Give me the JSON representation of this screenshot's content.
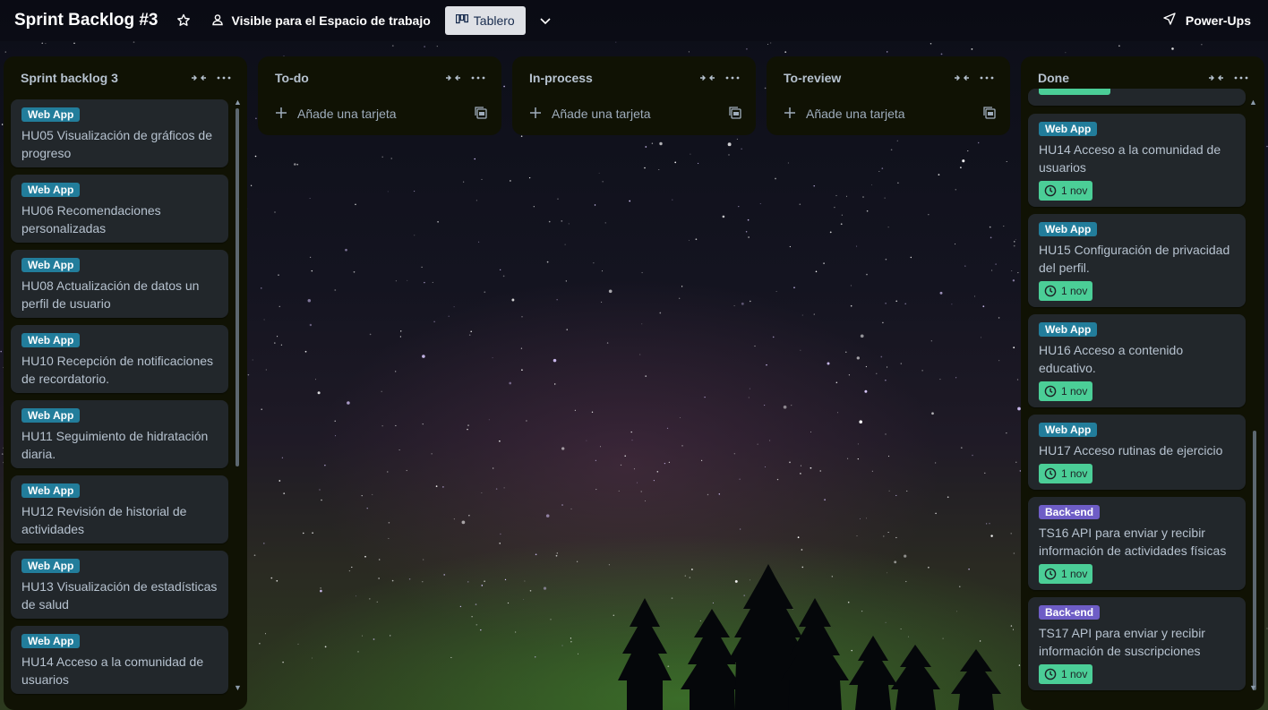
{
  "board": {
    "title": "Sprint Backlog #3",
    "visibility": "Visible para el Espacio de trabajo",
    "view": "Tablero",
    "powerups": "Power-Ups"
  },
  "icons": {
    "star": "star-icon",
    "visibility": "people-icon",
    "view": "board-icon",
    "chevron": "chevron-down-icon",
    "powerups": "rocket-icon",
    "collapse": "collapse-list-icon",
    "more": "more-dots-icon",
    "plus": "plus-icon",
    "template": "template-icon",
    "clock": "clock-icon"
  },
  "colors": {
    "webapp_label": "#227d9b",
    "backend_label": "#6e5dc6",
    "due_badge": "#4bce97",
    "list_bg": "#101204",
    "card_bg": "#22272b"
  },
  "lists": [
    {
      "title": "Sprint backlog 3",
      "cards": [
        {
          "label": "Web App",
          "title": "HU05 Visualización de gráficos de progreso"
        },
        {
          "label": "Web App",
          "title": "HU06 Recomendaciones personalizadas"
        },
        {
          "label": "Web App",
          "title": "HU08 Actualización de datos un perfil de usuario"
        },
        {
          "label": "Web App",
          "title": "HU10 Recepción de notificaciones de recordatorio."
        },
        {
          "label": "Web App",
          "title": "HU11 Seguimiento de hidratación diaria."
        },
        {
          "label": "Web App",
          "title": "HU12 Revisión de historial de actividades"
        },
        {
          "label": "Web App",
          "title": "HU13 Visualización de estadísticas de salud"
        },
        {
          "label": "Web App",
          "title": "HU14 Acceso a la comunidad de usuarios"
        }
      ]
    },
    {
      "title": "To-do",
      "add_label": "Añade una tarjeta"
    },
    {
      "title": "In-process",
      "add_label": "Añade una tarjeta"
    },
    {
      "title": "To-review",
      "add_label": "Añade una tarjeta"
    },
    {
      "title": "Done",
      "cards": [
        {
          "label": "Web App",
          "title": "HU14 Acceso a la comunidad de usuarios",
          "due": "1 nov"
        },
        {
          "label": "Web App",
          "title": "HU15 Configuración de privacidad del perfil.",
          "due": "1 nov"
        },
        {
          "label": "Web App",
          "title": "HU16 Acceso a contenido educativo.",
          "due": "1 nov"
        },
        {
          "label": "Web App",
          "title": "HU17 Acceso rutinas de ejercicio",
          "due": "1 nov"
        },
        {
          "label": "Back-end",
          "title": "TS16 API para enviar y recibir información de actividades físicas",
          "due": "1 nov"
        },
        {
          "label": "Back-end",
          "title": "TS17 API para enviar y recibir información de suscripciones",
          "due": "1 nov"
        }
      ]
    }
  ]
}
